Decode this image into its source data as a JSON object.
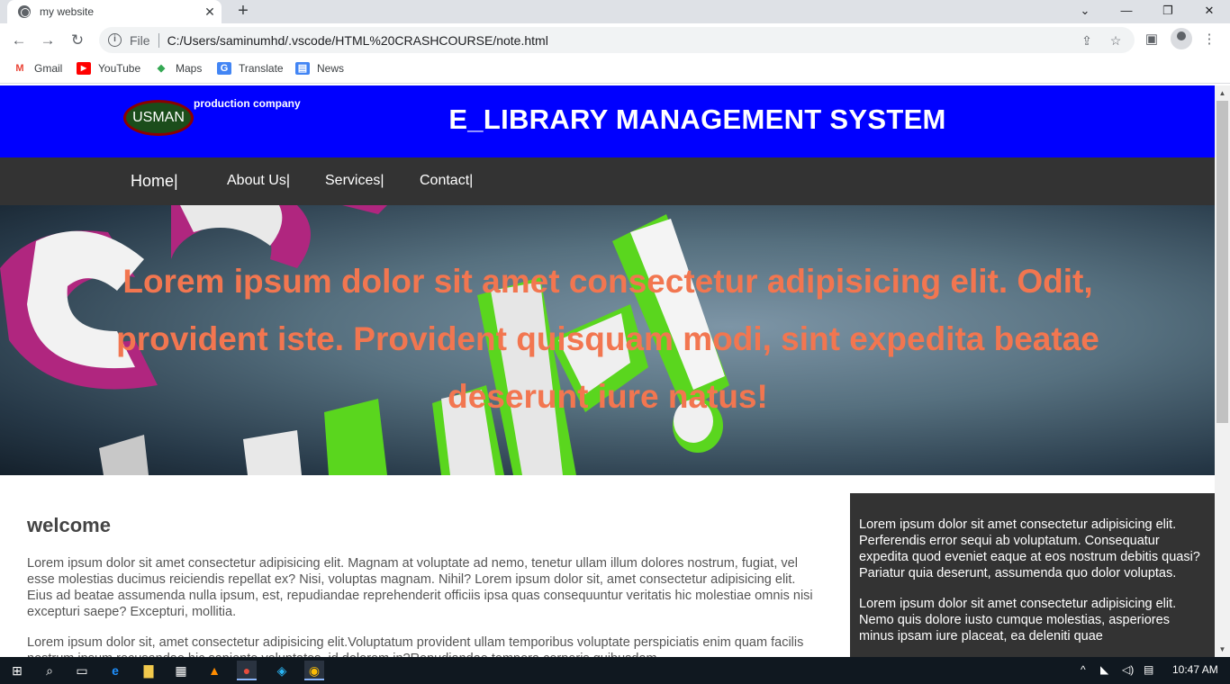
{
  "browser": {
    "tab_title": "my website",
    "new_tab": "+",
    "omnibox_scheme": "File",
    "url": "C:/Users/saminumhd/.vscode/HTML%20CRASHCOURSE/note.html",
    "bookmarks": [
      {
        "label": "Gmail",
        "icon": "gmail-icon",
        "color": "#ea4335",
        "glyph": "M"
      },
      {
        "label": "YouTube",
        "icon": "youtube-icon",
        "color": "#ff0000",
        "glyph": "▶"
      },
      {
        "label": "Maps",
        "icon": "maps-icon",
        "color": "#34a853",
        "glyph": "◆"
      },
      {
        "label": "Translate",
        "icon": "translate-icon",
        "color": "#4285f4",
        "glyph": "G"
      },
      {
        "label": "News",
        "icon": "news-icon",
        "color": "#4285f4",
        "glyph": "▤"
      }
    ]
  },
  "site": {
    "logo_text": "USMAN",
    "logo_tagline": "production company",
    "title": "E_LIBRARY MANAGEMENT SYSTEM",
    "nav": [
      "Home|",
      "About Us|",
      "Services|",
      "Contact|"
    ],
    "hero_text": "Lorem ipsum dolor sit amet consectetur adipisicing elit. Odit, provident iste. Provident quisquam modi, sint expedita beatae deserunt iure natus!",
    "main": {
      "heading": "welcome",
      "paragraphs": [
        "Lorem ipsum dolor sit amet consectetur adipisicing elit. Magnam at voluptate ad nemo, tenetur ullam illum dolores nostrum, fugiat, vel esse molestias ducimus reiciendis repellat ex? Nisi, voluptas magnam. Nihil? Lorem ipsum dolor sit, amet consectetur adipisicing elit. Eius ad beatae assumenda nulla ipsum, est, repudiandae reprehenderit officiis ipsa quas consequuntur veritatis hic molestiae omnis nisi excepturi saepe? Excepturi, mollitia.",
        "Lorem ipsum dolor sit, amet consectetur adipisicing elit.Voluptatum provident ullam temporibus voluptate perspiciatis enim quam facilis nostrum ipsum recusandae hic sapiente voluptates, id dolorem in?Repudiandae tempora corporis quibusdam"
      ]
    },
    "sidebar": {
      "paragraphs": [
        "Lorem ipsum dolor sit amet consectetur adipisicing elit. Perferendis error sequi ab voluptatum. Consequatur expedita quod eveniet eaque at eos nostrum debitis quasi? Pariatur quia deserunt, assumenda quo dolor voluptas.",
        "Lorem ipsum dolor sit amet consectetur adipisicing elit. Nemo quis dolore iusto cumque molestias, asperiores minus ipsam iure placeat, ea deleniti quae"
      ]
    },
    "colors": {
      "header_bg": "#0000ff",
      "nav_bg": "#333333",
      "hero_text": "#f27650",
      "sidebar_bg": "#333333"
    }
  },
  "taskbar": {
    "time": "10:47 AM"
  }
}
